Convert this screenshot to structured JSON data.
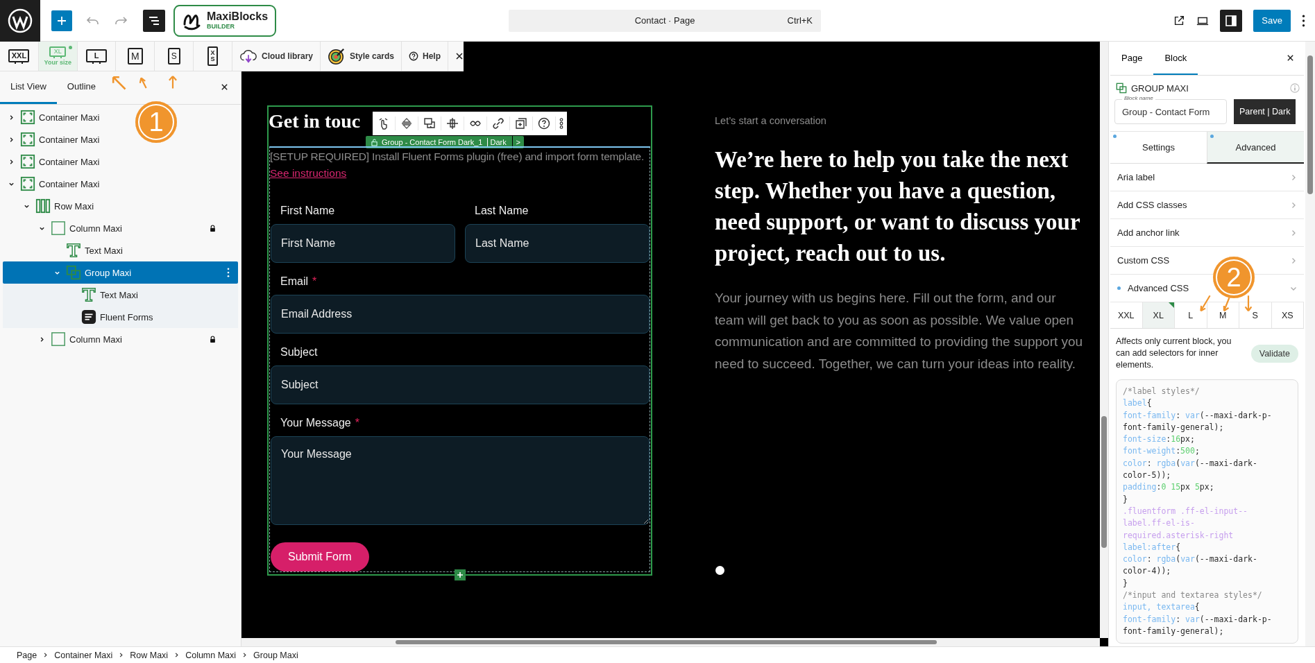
{
  "top_bar": {
    "logo_name": "MaxiBlocks",
    "logo_sub": "BUILDER",
    "command": "Contact · Page",
    "shortcut": "Ctrl+K",
    "save": "Save"
  },
  "responsive_toolbar": {
    "sizes": [
      {
        "label": "XXL",
        "kind": "desktop",
        "selected": false,
        "current": false
      },
      {
        "label": "XL",
        "kind": "desktop",
        "caption": "Your size",
        "selected": true,
        "current": true
      },
      {
        "label": "L",
        "kind": "desktop",
        "selected": false,
        "current": false
      },
      {
        "label": "M",
        "kind": "tablet",
        "selected": false,
        "current": false
      },
      {
        "label": "S",
        "kind": "phone",
        "selected": false,
        "current": false
      },
      {
        "label": "XS",
        "kind": "narrow",
        "selected": false,
        "current": false
      }
    ],
    "buttons": [
      {
        "label": "Cloud library",
        "kind": "cloud"
      },
      {
        "label": "Style cards",
        "kind": "palette"
      },
      {
        "label": "Help",
        "kind": "help"
      }
    ]
  },
  "left_panel": {
    "tabs": [
      {
        "label": "List View",
        "selected": true
      },
      {
        "label": "Outline",
        "selected": false
      }
    ],
    "annotation": "1",
    "tree": [
      {
        "label": "Container Maxi",
        "kind": "container",
        "expanded": false,
        "locked": false,
        "selected": false
      },
      {
        "label": "Container Maxi",
        "kind": "container",
        "expanded": false,
        "locked": false,
        "selected": false
      },
      {
        "label": "Container Maxi",
        "kind": "container",
        "expanded": false,
        "locked": false,
        "selected": false
      },
      {
        "label": "Container Maxi",
        "kind": "container",
        "expanded": true,
        "locked": false,
        "selected": false,
        "children": [
          {
            "label": "Row Maxi",
            "kind": "row",
            "expanded": true,
            "locked": false,
            "selected": false,
            "children": [
              {
                "label": "Column Maxi",
                "kind": "column",
                "expanded": true,
                "locked": true,
                "selected": false,
                "children": [
                  {
                    "label": "Text Maxi",
                    "kind": "text",
                    "locked": false,
                    "selected": false
                  },
                  {
                    "label": "Group Maxi",
                    "kind": "group",
                    "expanded": true,
                    "locked": false,
                    "selected": true,
                    "children": [
                      {
                        "label": "Text Maxi",
                        "kind": "text",
                        "locked": false,
                        "selected": false
                      },
                      {
                        "label": "Fluent Forms",
                        "kind": "forms",
                        "locked": false,
                        "selected": false
                      }
                    ]
                  }
                ]
              },
              {
                "label": "Column Maxi",
                "kind": "column",
                "expanded": false,
                "locked": true,
                "selected": false
              }
            ]
          }
        ]
      }
    ]
  },
  "canvas": {
    "heading": "Get in touc",
    "block_label": {
      "name": "Group - Contact Form Dark_1",
      "style": "Dark",
      "more": ">"
    },
    "notice": "[SETUP REQUIRED] Install Fluent Forms plugin (free) and import form template.",
    "link": "See instructions",
    "fields": [
      {
        "label": "First Name",
        "placeholder": "First Name",
        "kind": "half",
        "required": false
      },
      {
        "label": "Last Name",
        "placeholder": "Last Name",
        "kind": "half",
        "required": false
      },
      {
        "label": "Email",
        "placeholder": "Email Address",
        "kind": "full",
        "required": true
      },
      {
        "label": "Subject",
        "placeholder": "Subject",
        "kind": "full",
        "required": false
      },
      {
        "label": "Your Message",
        "placeholder": "Your Message",
        "kind": "textarea",
        "required": true
      }
    ],
    "required_mark": "*",
    "submit": "Submit Form",
    "eyebrow": "Let’s start a conversation",
    "headline": "We’re here to help you take the next step. Whether you have a question, need support, or want to discuss your project, reach out to us.",
    "paragraph": "Your journey with us begins here. Fill out the form, and our team will get back to you as soon as possible. We value open communication and are committed to providing the support you need to succeed. Together, we can turn your ideas into reality."
  },
  "right_panel": {
    "tabs": [
      {
        "label": "Page",
        "selected": false
      },
      {
        "label": "Block",
        "selected": true
      }
    ],
    "block_type": "GROUP MAXI",
    "block_name_label": "Block name",
    "block_name": "Group - Contact Form",
    "parent_button": "Parent | Dark",
    "subtabs": [
      {
        "label": "Settings",
        "selected": false,
        "modified": true
      },
      {
        "label": "Advanced",
        "selected": true,
        "modified": true
      }
    ],
    "annotation": "2",
    "sections": [
      {
        "label": "Aria label",
        "expanded": false,
        "modified": false
      },
      {
        "label": "Add CSS classes",
        "expanded": false,
        "modified": false
      },
      {
        "label": "Add anchor link",
        "expanded": false,
        "modified": false
      },
      {
        "label": "Custom CSS",
        "expanded": false,
        "modified": false
      },
      {
        "label": "Advanced CSS",
        "expanded": true,
        "modified": true
      }
    ],
    "breakpoints": [
      {
        "label": "XXL",
        "selected": false,
        "modified": false
      },
      {
        "label": "XL",
        "selected": true,
        "modified": true
      },
      {
        "label": "L",
        "selected": false,
        "modified": false
      },
      {
        "label": "M",
        "selected": false,
        "modified": false
      },
      {
        "label": "S",
        "selected": false,
        "modified": false
      },
      {
        "label": "XS",
        "selected": false,
        "modified": false
      }
    ],
    "description": "Affects only current block, you can add selectors for inner elements.",
    "validate": "Validate",
    "code": [
      [
        {
          "kind": "comment",
          "text": "/*label styles*/"
        }
      ],
      [
        {
          "kind": "keyword",
          "text": "label"
        },
        {
          "kind": "plain",
          "text": "{"
        }
      ],
      [
        {
          "kind": "keyword",
          "text": "font-family"
        },
        {
          "kind": "plain",
          "text": ": "
        },
        {
          "kind": "keyword",
          "text": "var"
        },
        {
          "kind": "plain",
          "text": "(--maxi-dark-p-"
        }
      ],
      [
        {
          "kind": "plain",
          "text": "font-family-general);"
        }
      ],
      [
        {
          "kind": "keyword",
          "text": "font-size"
        },
        {
          "kind": "plain",
          "text": ":"
        },
        {
          "kind": "number",
          "text": "16"
        },
        {
          "kind": "plain",
          "text": "px;"
        }
      ],
      [
        {
          "kind": "keyword",
          "text": "font-weight"
        },
        {
          "kind": "plain",
          "text": ":"
        },
        {
          "kind": "number",
          "text": "500"
        },
        {
          "kind": "plain",
          "text": ";"
        }
      ],
      [
        {
          "kind": "keyword",
          "text": "color"
        },
        {
          "kind": "plain",
          "text": ": "
        },
        {
          "kind": "keyword",
          "text": "rgba"
        },
        {
          "kind": "plain",
          "text": "("
        },
        {
          "kind": "keyword",
          "text": "var"
        },
        {
          "kind": "plain",
          "text": "(--maxi-dark-"
        }
      ],
      [
        {
          "kind": "plain",
          "text": "color-5));"
        }
      ],
      [
        {
          "kind": "keyword",
          "text": "padding"
        },
        {
          "kind": "plain",
          "text": ":"
        },
        {
          "kind": "number",
          "text": "0 15"
        },
        {
          "kind": "plain",
          "text": "px "
        },
        {
          "kind": "number",
          "text": "5"
        },
        {
          "kind": "plain",
          "text": "px;"
        }
      ],
      [
        {
          "kind": "plain",
          "text": "}"
        }
      ],
      [
        {
          "kind": "selector",
          "text": ".fluentform .ff-el-input--"
        }
      ],
      [
        {
          "kind": "selector",
          "text": "label.ff-el-is-"
        }
      ],
      [
        {
          "kind": "selector",
          "text": "required.asterisk-right"
        }
      ],
      [
        {
          "kind": "keyword",
          "text": "label:after"
        },
        {
          "kind": "plain",
          "text": "{"
        }
      ],
      [
        {
          "kind": "keyword",
          "text": "color"
        },
        {
          "kind": "plain",
          "text": ": "
        },
        {
          "kind": "keyword",
          "text": "rgba"
        },
        {
          "kind": "plain",
          "text": "("
        },
        {
          "kind": "keyword",
          "text": "var"
        },
        {
          "kind": "plain",
          "text": "(--maxi-dark-"
        }
      ],
      [
        {
          "kind": "plain",
          "text": "color-4));"
        }
      ],
      [
        {
          "kind": "plain",
          "text": "}"
        }
      ],
      [
        {
          "kind": "comment",
          "text": "/*input and textarea styles*/"
        }
      ],
      [
        {
          "kind": "keyword",
          "text": "input, textarea"
        },
        {
          "kind": "plain",
          "text": "{"
        }
      ],
      [
        {
          "kind": "keyword",
          "text": "font-family"
        },
        {
          "kind": "plain",
          "text": ": "
        },
        {
          "kind": "keyword",
          "text": "var"
        },
        {
          "kind": "plain",
          "text": "(--maxi-dark-p-"
        }
      ],
      [
        {
          "kind": "plain",
          "text": "font-family-general);"
        }
      ]
    ]
  },
  "status_bar": {
    "breadcrumbs": [
      "Page",
      "Container Maxi",
      "Row Maxi",
      "Column Maxi",
      "Group Maxi"
    ]
  }
}
